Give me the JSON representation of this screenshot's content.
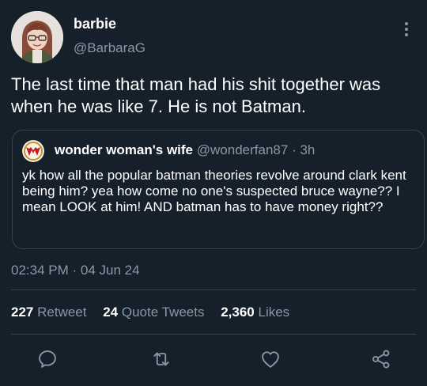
{
  "user": {
    "display_name": "barbie",
    "handle": "@BarbaraG"
  },
  "tweet": {
    "text": "The last time that man had his shit together was when he was like 7. He is not Batman.",
    "timestamp": "02:34 PM · 04 Jun 24"
  },
  "quoted_tweet": {
    "display_name": "wonder woman's wife",
    "handle": "@wonderfan87",
    "separator": "·",
    "time": "3h",
    "text": "yk how all the popular batman theories revolve around clark kent being him? yea how come no one's suspected bruce wayne?? I mean LOOK at him! AND batman has to have money right??"
  },
  "stats": {
    "retweets_count": "227",
    "retweets_label": "Retweet",
    "quotes_count": "24",
    "quotes_label": "Quote Tweets",
    "likes_count": "2,360",
    "likes_label": "Likes"
  },
  "icons": {
    "more": "more-vertical-icon",
    "reply": "reply-icon",
    "retweet": "retweet-icon",
    "like": "heart-icon",
    "share": "share-icon"
  },
  "colors": {
    "background": "#15202b",
    "secondary_text": "#8899a6",
    "border": "#38444d",
    "primary_text": "#ffffff"
  }
}
